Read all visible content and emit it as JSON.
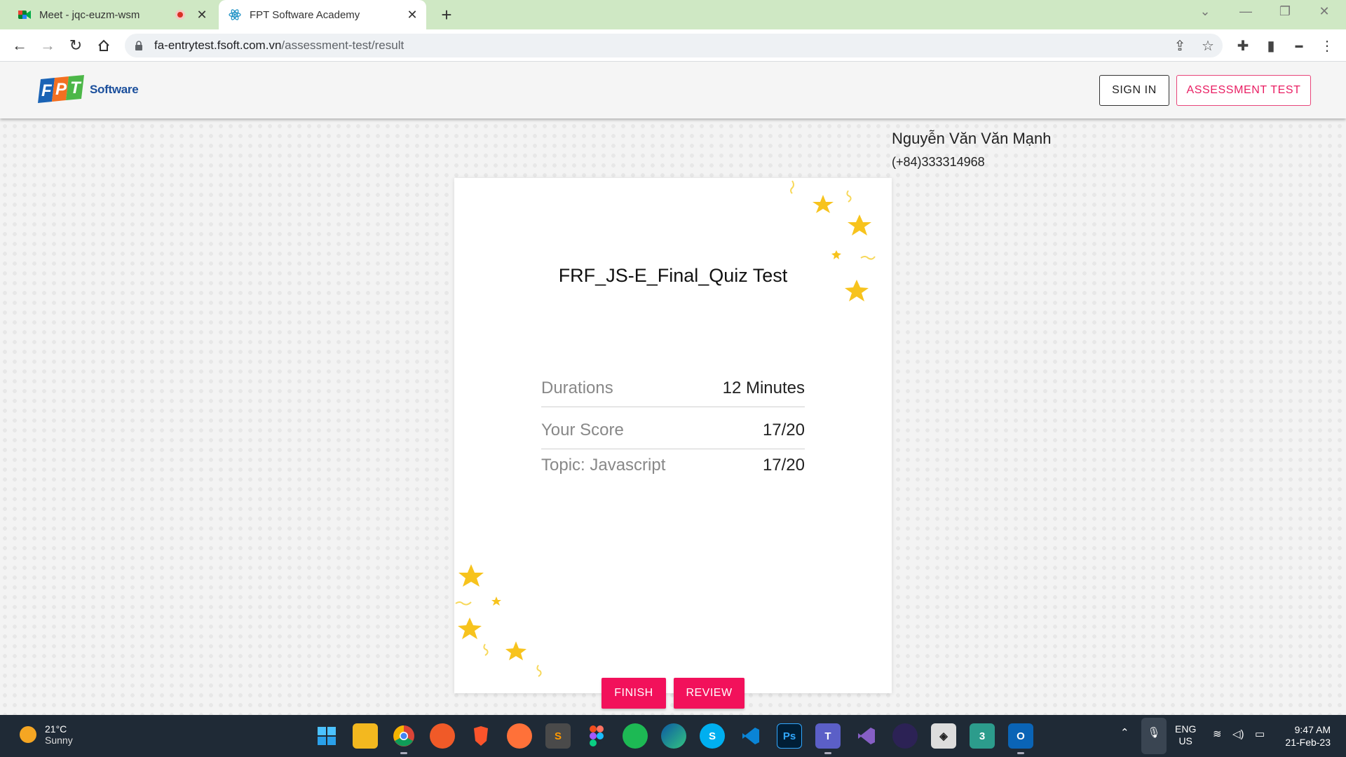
{
  "browser": {
    "tabs": [
      {
        "title": "Meet - jqc-euzm-wsm",
        "active": false
      },
      {
        "title": "FPT Software Academy",
        "active": true
      }
    ],
    "new_tab": "+",
    "url_host": "fa-entrytest.fsoft.com.vn",
    "url_path": "/assessment-test/result"
  },
  "header": {
    "logo_software": "Software",
    "sign_in": "SIGN IN",
    "assessment_test": "ASSESSMENT TEST"
  },
  "user": {
    "name": "Nguyễn Văn Văn Mạnh",
    "phone": "(+84)333314968"
  },
  "result": {
    "title": "FRF_JS-E_Final_Quiz Test",
    "rows": [
      {
        "label": "Durations",
        "value": "12 Minutes"
      },
      {
        "label": "Your Score",
        "value": "17/20"
      },
      {
        "label": "Topic: Javascript",
        "value": "17/20"
      }
    ],
    "finish": "FINISH",
    "review": "REVIEW"
  },
  "taskbar": {
    "temperature": "21°C",
    "weather": "Sunny",
    "lang1": "ENG",
    "lang2": "US",
    "time": "9:47 AM",
    "date": "21-Feb-23"
  },
  "colors": {
    "accent": "#f2115b",
    "star": "#f7c31d",
    "tab_strip": "#cfe8c4"
  }
}
